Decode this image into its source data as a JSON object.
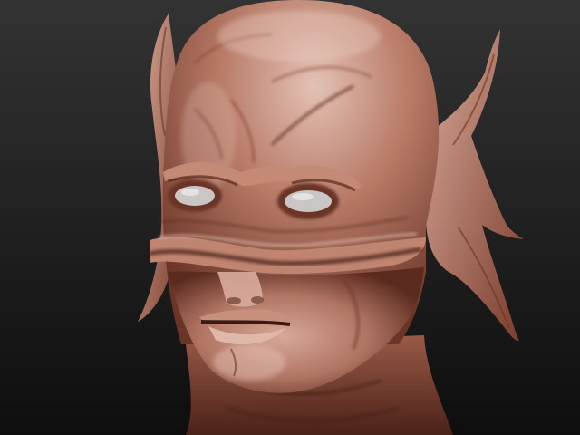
{
  "scene": {
    "subject": "sculpted-creature-head",
    "colors": {
      "background_top": "#333333",
      "background_bottom": "#0e0e0e",
      "skin_highlight": "#e3c2b6",
      "skin_mid": "#b97c68",
      "skin_shadow": "#6a3426",
      "skin_deep": "#3a1a12",
      "eye_white": "#c9c6c5"
    }
  }
}
